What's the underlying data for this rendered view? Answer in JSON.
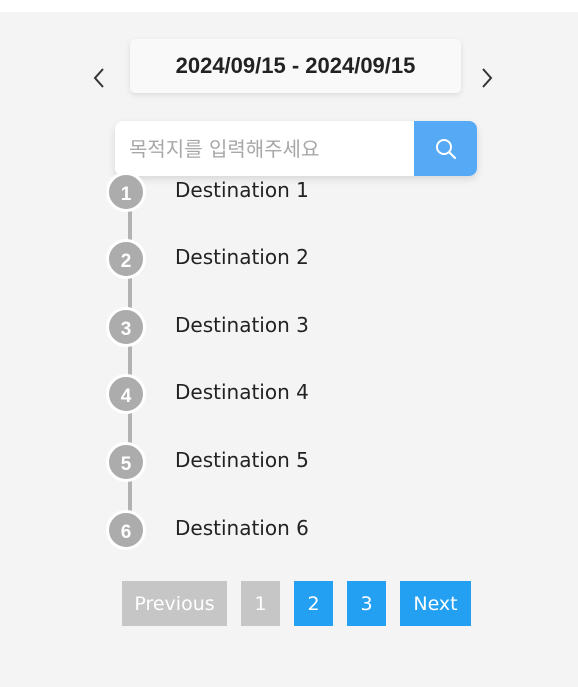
{
  "date_range": {
    "label": "2024/09/15 - 2024/09/15",
    "prev_icon": "chevron-left-icon",
    "next_icon": "chevron-right-icon"
  },
  "search": {
    "placeholder": "목적지를 입력해주세요",
    "value": "",
    "button_icon": "search-icon",
    "button_color": "#56aaf5"
  },
  "destinations": [
    {
      "number": "1",
      "label": "Destination 1"
    },
    {
      "number": "2",
      "label": "Destination 2"
    },
    {
      "number": "3",
      "label": "Destination 3"
    },
    {
      "number": "4",
      "label": "Destination 4"
    },
    {
      "number": "5",
      "label": "Destination 5"
    },
    {
      "number": "6",
      "label": "Destination 6"
    }
  ],
  "pagination": {
    "previous_label": "Previous",
    "next_label": "Next",
    "pages": [
      "1",
      "2",
      "3"
    ],
    "current_page": "1",
    "disabled_color": "#c6c6c6",
    "active_color": "#23a0f2"
  }
}
